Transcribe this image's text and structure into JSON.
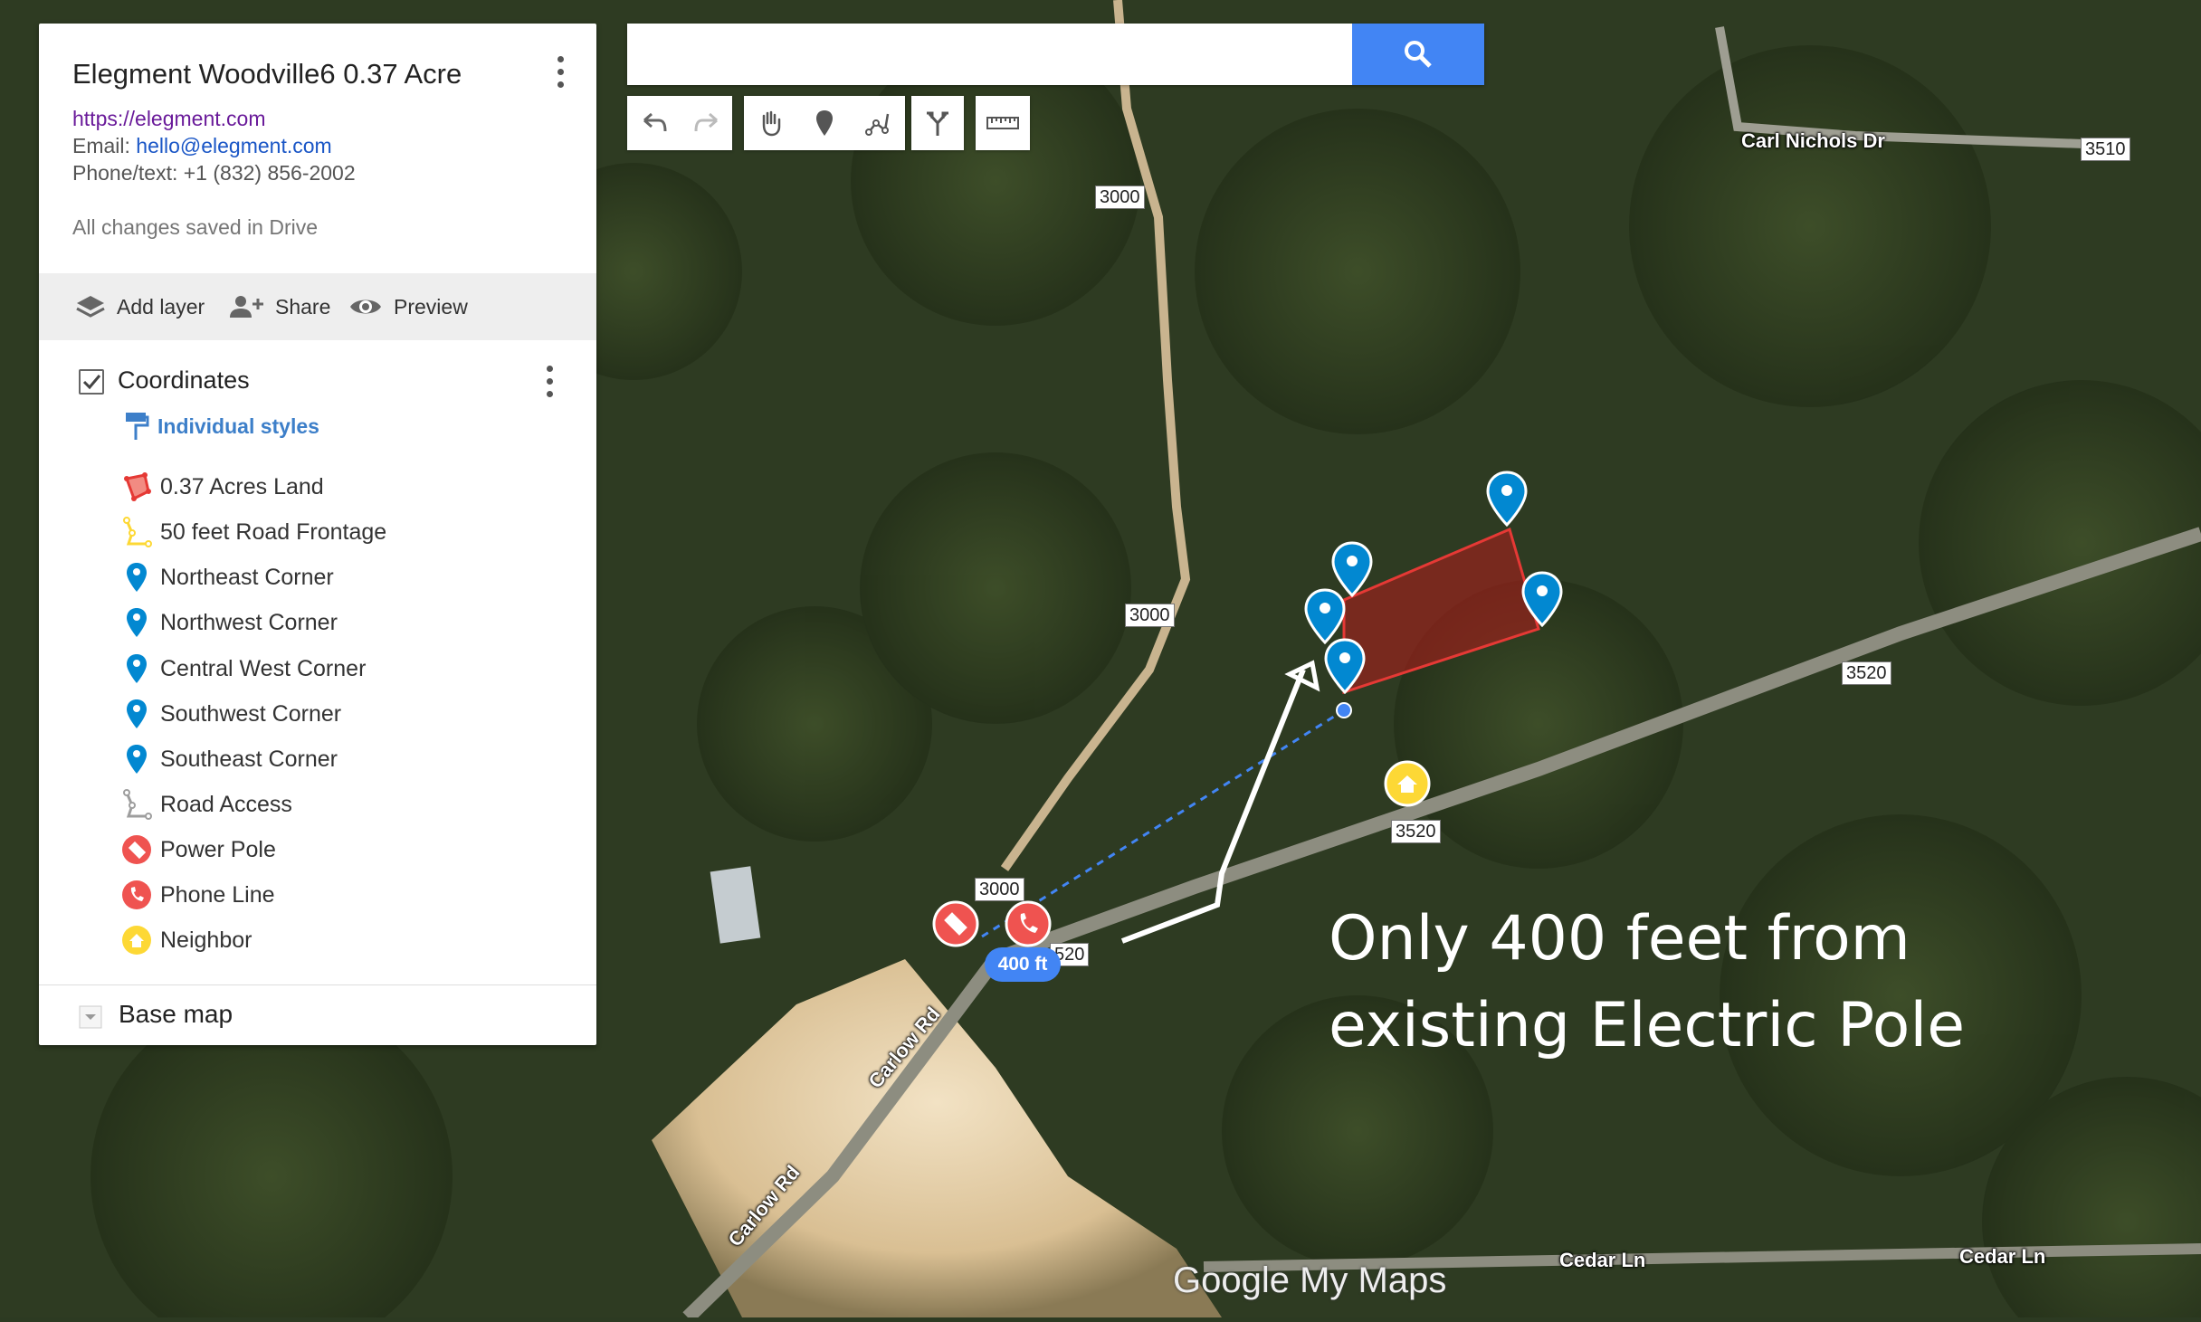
{
  "panel": {
    "title": "Elegment Woodville6 0.37 Acre",
    "website": "https://elegment.com",
    "email_label": "Email:",
    "email": "hello@elegment.com",
    "phone": "Phone/text: +1 (832) 856-2002",
    "saved": "All changes saved in Drive",
    "toolbar": {
      "add_layer": "Add layer",
      "share": "Share",
      "preview": "Preview"
    },
    "layer": {
      "title": "Coordinates",
      "styles": "Individual styles",
      "items": [
        {
          "label": "0.37 Acres Land",
          "icon": "polygon-icon",
          "color": "#e53935"
        },
        {
          "label": "50 feet Road Frontage",
          "icon": "line-icon",
          "color": "#fdd835"
        },
        {
          "label": "Northeast Corner",
          "icon": "pin-icon",
          "color": "#0288d1"
        },
        {
          "label": "Northwest Corner",
          "icon": "pin-icon",
          "color": "#0288d1"
        },
        {
          "label": "Central West Corner",
          "icon": "pin-icon",
          "color": "#0288d1"
        },
        {
          "label": "Southwest Corner",
          "icon": "pin-icon",
          "color": "#0288d1"
        },
        {
          "label": "Southeast Corner",
          "icon": "pin-icon",
          "color": "#0288d1"
        },
        {
          "label": "Road Access",
          "icon": "line-icon",
          "color": "#9e9e9e"
        },
        {
          "label": "Power Pole",
          "icon": "plug-icon",
          "color": "#ef5350"
        },
        {
          "label": "Phone Line",
          "icon": "phone-icon",
          "color": "#ef5350"
        },
        {
          "label": "Neighbor",
          "icon": "house-icon",
          "color": "#fdd835"
        }
      ]
    },
    "base_map": "Base map"
  },
  "map": {
    "road_numbers": [
      "3000",
      "3000",
      "3000",
      "3510",
      "3520",
      "3520",
      "520"
    ],
    "road_names": [
      "Carl Nichols Dr",
      "Carlow Rd",
      "Carlow Rd",
      "Cedar Ln",
      "Cedar Ln"
    ],
    "distance_label": "400 ft",
    "annotation": [
      "Only 400 feet from",
      "existing Electric Pole"
    ],
    "brand": "Google My Maps"
  }
}
